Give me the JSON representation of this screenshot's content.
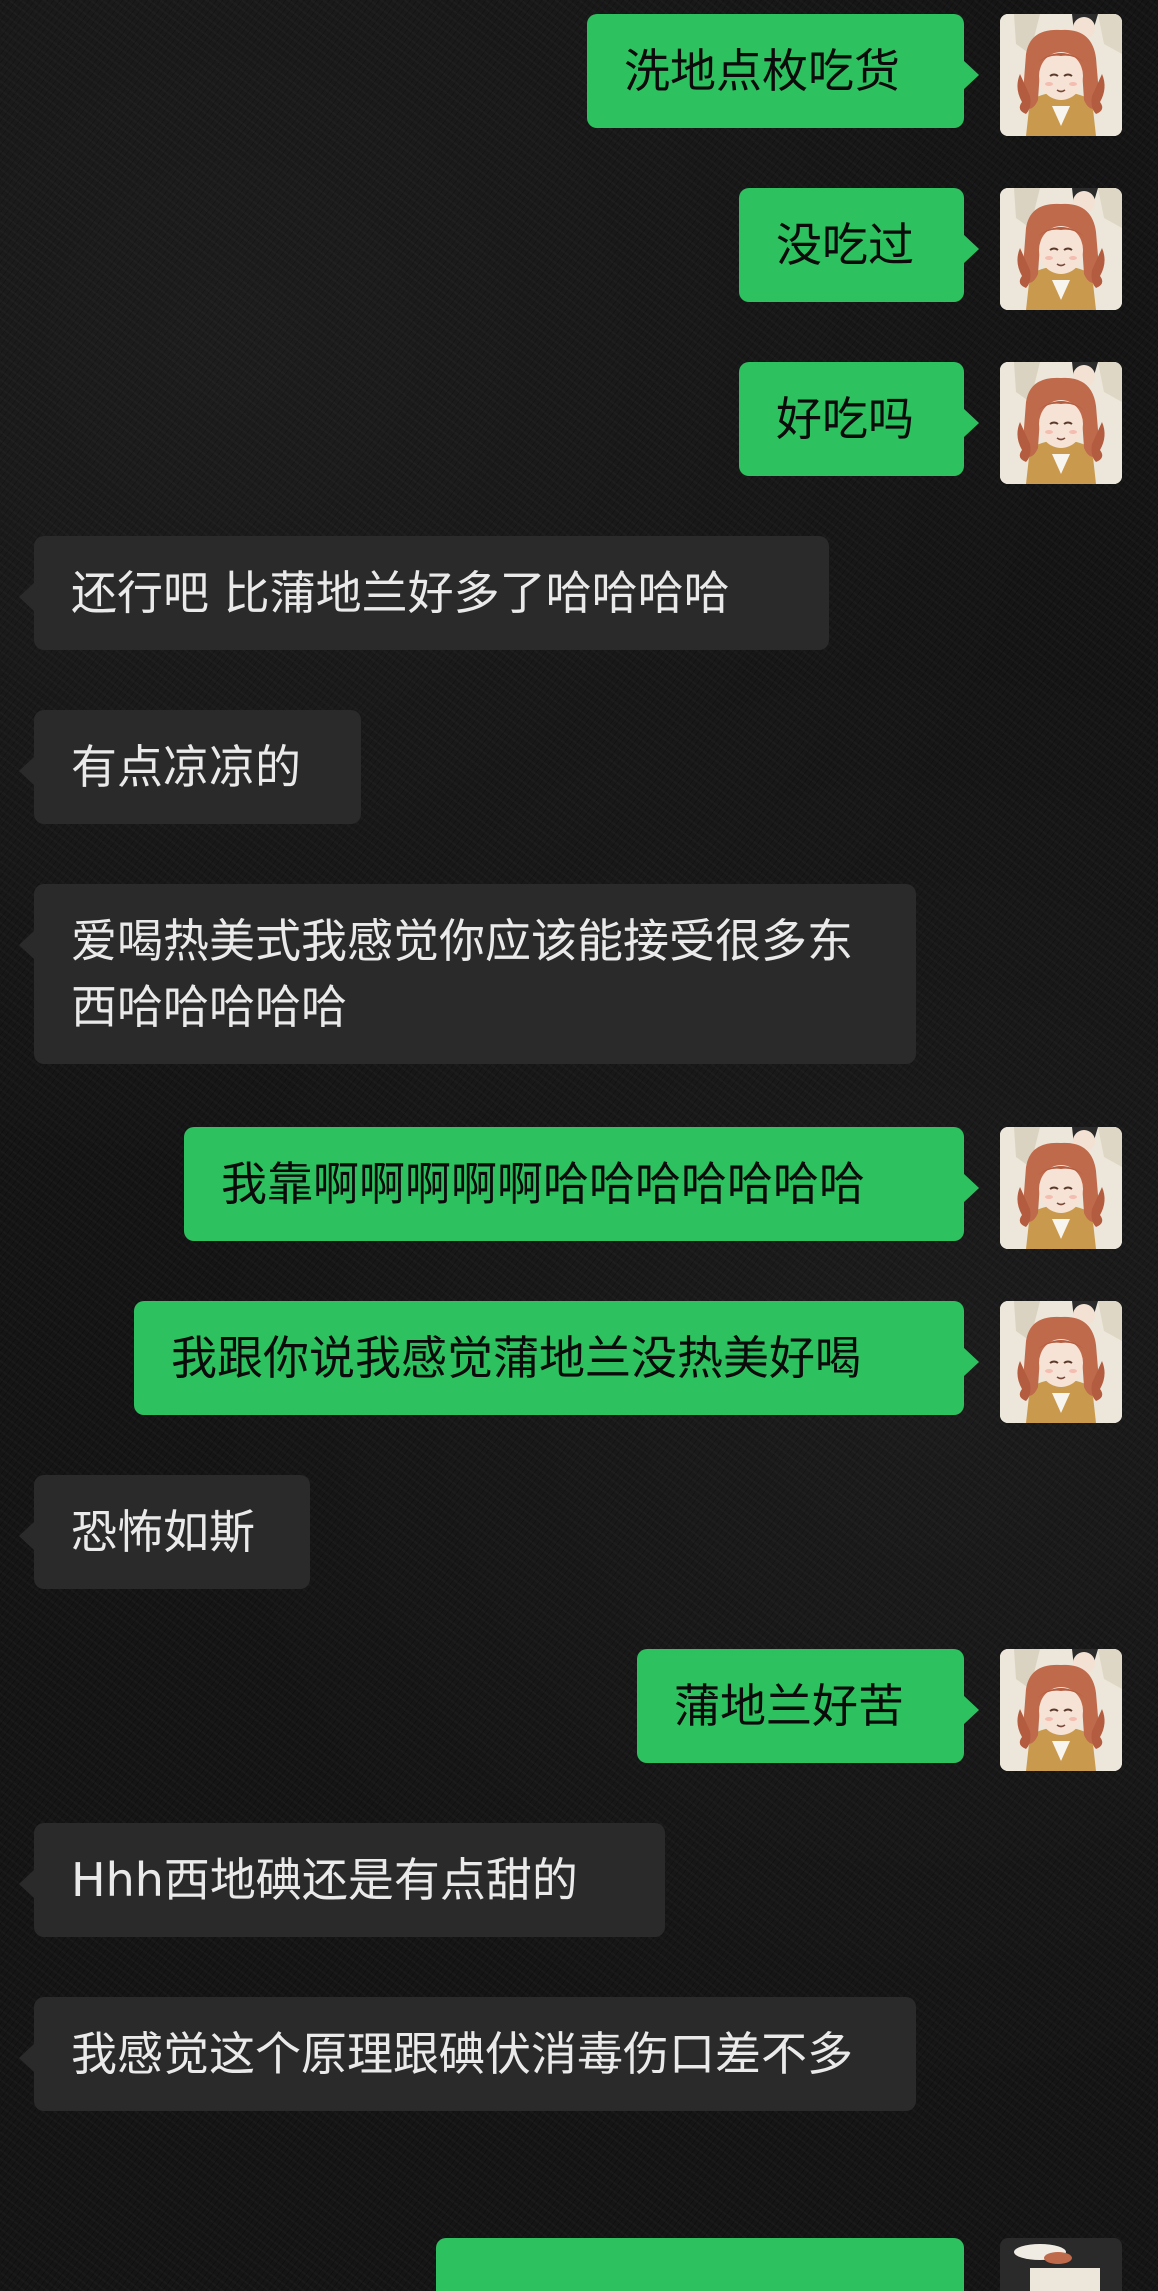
{
  "chat": {
    "messages": [
      {
        "side": "sent",
        "text": "洗地点枚吃货"
      },
      {
        "side": "sent",
        "text": "没吃过"
      },
      {
        "side": "sent",
        "text": "好吃吗"
      },
      {
        "side": "received",
        "text": "还行吧 比蒲地兰好多了哈哈哈哈"
      },
      {
        "side": "received",
        "text": "有点凉凉的"
      },
      {
        "side": "received",
        "text": "爱喝热美式我感觉你应该能接受很多东西哈哈哈哈哈"
      },
      {
        "side": "sent",
        "text": "我靠啊啊啊啊啊哈哈哈哈哈哈哈"
      },
      {
        "side": "sent",
        "text": "我跟你说我感觉蒲地兰没热美好喝"
      },
      {
        "side": "received",
        "text": "恐怖如斯"
      },
      {
        "side": "sent",
        "text": "蒲地兰好苦"
      },
      {
        "side": "received",
        "text": "Hhh西地碘还是有点甜的"
      },
      {
        "side": "received",
        "text": "我感觉这个原理跟碘伏消毒伤口差不多"
      }
    ]
  },
  "colors": {
    "sent_bubble": "#2ec15f",
    "received_bubble": "#2a2a2a",
    "background": "#151515"
  },
  "avatar_icon": "user-avatar-illustration"
}
